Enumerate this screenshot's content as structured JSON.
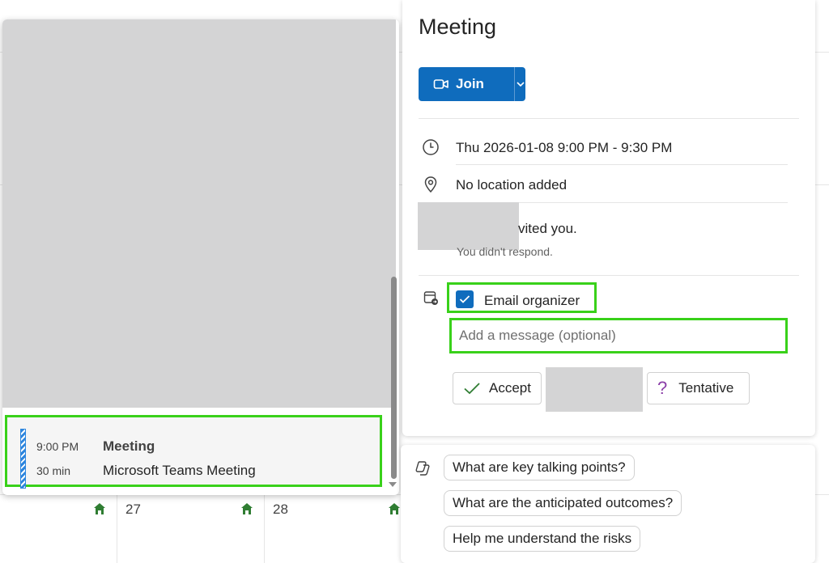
{
  "calendar": {
    "days": [
      {
        "label": "27"
      },
      {
        "label": "28"
      }
    ]
  },
  "event_list": {
    "selected_event": {
      "time": "9:00 PM",
      "duration": "30 min",
      "title": "Meeting",
      "location": "Microsoft Teams Meeting"
    }
  },
  "details": {
    "title": "Meeting",
    "join_label": "Join",
    "datetime": "Thu 2026-01-08 9:00 PM - 9:30 PM",
    "location": "No location added",
    "invite_text": "vited you.",
    "response_status": "You didn't respond.",
    "email_organizer_label": "Email organizer",
    "email_organizer_checked": true,
    "message_placeholder": "Add a message (optional)",
    "accept_label": "Accept",
    "tentative_label": "Tentative"
  },
  "copilot": {
    "suggestions": [
      "What are key talking points?",
      "What are the anticipated outcomes?",
      "Help me understand the risks"
    ]
  },
  "colors": {
    "brand": "#0f6cbd",
    "highlight": "#39d11a",
    "home_icon": "#2f7d32",
    "accept_check": "#2f7d32",
    "tentative_icon": "#8b3fa8"
  }
}
